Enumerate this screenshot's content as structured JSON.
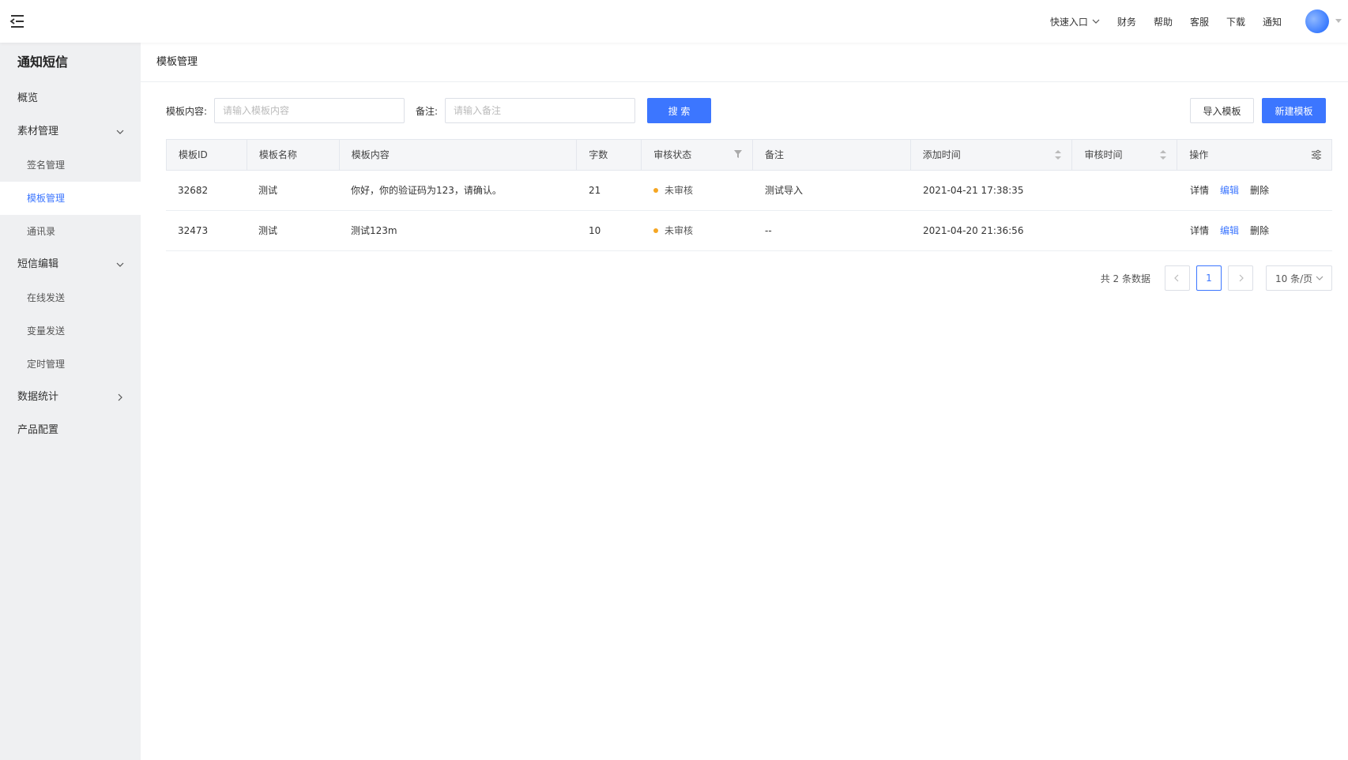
{
  "header": {
    "nav": [
      "快速入口",
      "财务",
      "帮助",
      "客服",
      "下载",
      "通知"
    ]
  },
  "sidebar": {
    "title": "通知短信",
    "items": [
      {
        "label": "概览",
        "type": "top"
      },
      {
        "label": "素材管理",
        "type": "group",
        "expanded": true
      },
      {
        "label": "签名管理",
        "type": "sub"
      },
      {
        "label": "模板管理",
        "type": "sub",
        "active": true
      },
      {
        "label": "通讯录",
        "type": "sub"
      },
      {
        "label": "短信编辑",
        "type": "group",
        "expanded": true
      },
      {
        "label": "在线发送",
        "type": "sub"
      },
      {
        "label": "变量发送",
        "type": "sub"
      },
      {
        "label": "定时管理",
        "type": "sub"
      },
      {
        "label": "数据统计",
        "type": "group",
        "expanded": false
      },
      {
        "label": "产品配置",
        "type": "top"
      }
    ]
  },
  "page": {
    "title": "模板管理"
  },
  "filters": {
    "content_label": "模板内容:",
    "content_placeholder": "请输入模板内容",
    "content_value": "",
    "remark_label": "备注:",
    "remark_placeholder": "请输入备注",
    "remark_value": "",
    "search_button": "搜 索",
    "import_button": "导入模板",
    "new_button": "新建模板"
  },
  "table": {
    "columns": [
      "模板ID",
      "模板名称",
      "模板内容",
      "字数",
      "审核状态",
      "备注",
      "添加时间",
      "审核时间",
      "操作"
    ],
    "rows": [
      {
        "id": "32682",
        "name": "测试",
        "content": "你好，你的验证码为123，请确认。",
        "count": "21",
        "status": "未审核",
        "remark": "测试导入",
        "added": "2021-04-21 17:38:35",
        "reviewed": "",
        "ops": [
          "详情",
          "编辑",
          "删除"
        ]
      },
      {
        "id": "32473",
        "name": "测试",
        "content": "测试123m",
        "count": "10",
        "status": "未审核",
        "remark": "--",
        "added": "2021-04-20 21:36:56",
        "reviewed": "",
        "ops": [
          "详情",
          "编辑",
          "删除"
        ]
      }
    ]
  },
  "pagination": {
    "total_text": "共 2 条数据",
    "current_page": "1",
    "page_size": "10 条/页"
  },
  "colors": {
    "accent": "#3c76ff",
    "status_pending": "#f5a623",
    "sidebar_bg": "#eff0f2"
  },
  "icons": {
    "menu_toggle": "menu-fold-icon",
    "filter": "filter-icon",
    "sort": "sort-icon",
    "column_settings": "settings-icon"
  }
}
